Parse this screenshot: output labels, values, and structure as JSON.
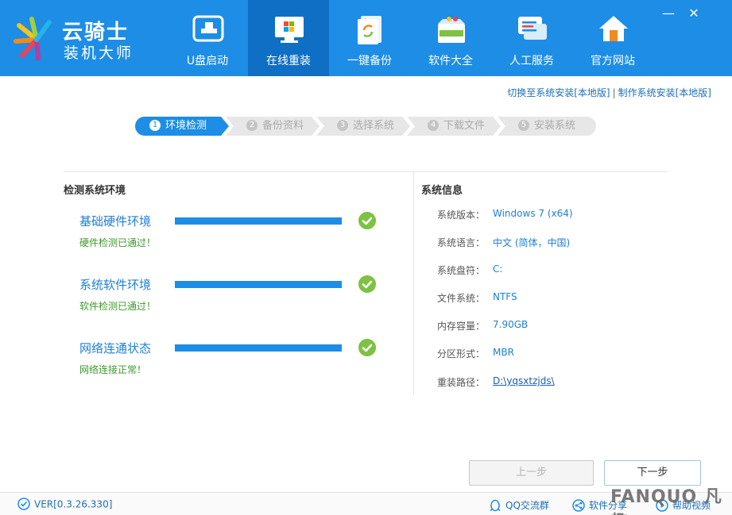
{
  "app": {
    "logo_line1": "云骑士",
    "logo_line2": "装机大师"
  },
  "nav": [
    {
      "label": "U盘启动"
    },
    {
      "label": "在线重装"
    },
    {
      "label": "一键备份"
    },
    {
      "label": "软件大全"
    },
    {
      "label": "人工服务"
    },
    {
      "label": "官方网站"
    }
  ],
  "window_controls": {
    "minimize": "—",
    "close": "✕"
  },
  "top_links": {
    "switch_install": "切换至系统安装[本地版]",
    "separator": "|",
    "make_install": "制作系统安装[本地版]"
  },
  "steps": [
    {
      "num": "1",
      "label": "环境检测"
    },
    {
      "num": "2",
      "label": "备份资料"
    },
    {
      "num": "3",
      "label": "选择系统"
    },
    {
      "num": "4",
      "label": "下载文件"
    },
    {
      "num": "5",
      "label": "安装系统"
    }
  ],
  "check": {
    "title": "检测系统环境",
    "items": [
      {
        "title": "基础硬件环境",
        "status": "硬件检测已通过！",
        "progress": 1.0
      },
      {
        "title": "系统软件环境",
        "status": "软件检测已通过！",
        "progress": 1.0
      },
      {
        "title": "网络连通状态",
        "status": "网络连接正常！",
        "progress": 1.0
      }
    ]
  },
  "sysinfo": {
    "title": "系统信息",
    "rows": [
      {
        "label": "系统版本：",
        "value": "Windows 7 (x64)"
      },
      {
        "label": "系统语言：",
        "value": "中文 (简体，中国)"
      },
      {
        "label": "系统盘符：",
        "value": "C:"
      },
      {
        "label": "文件系统：",
        "value": "NTFS"
      },
      {
        "label": "内存容量：",
        "value": "7.90GB"
      },
      {
        "label": "分区形式：",
        "value": "MBR"
      },
      {
        "label": "重装路径：",
        "value": "D:\\yqsxtzjds\\"
      }
    ]
  },
  "buttons": {
    "prev": "上一步",
    "next": "下一步"
  },
  "footer": {
    "version": "VER[0.3.26.330]",
    "qq_group": "QQ交流群",
    "share": "软件分享",
    "help": "帮助视频"
  },
  "watermark": "FANQUO 凡趣",
  "colors": {
    "brand": "#1d8de6",
    "nav_active": "#0f6fc4",
    "success": "#7dc242"
  }
}
